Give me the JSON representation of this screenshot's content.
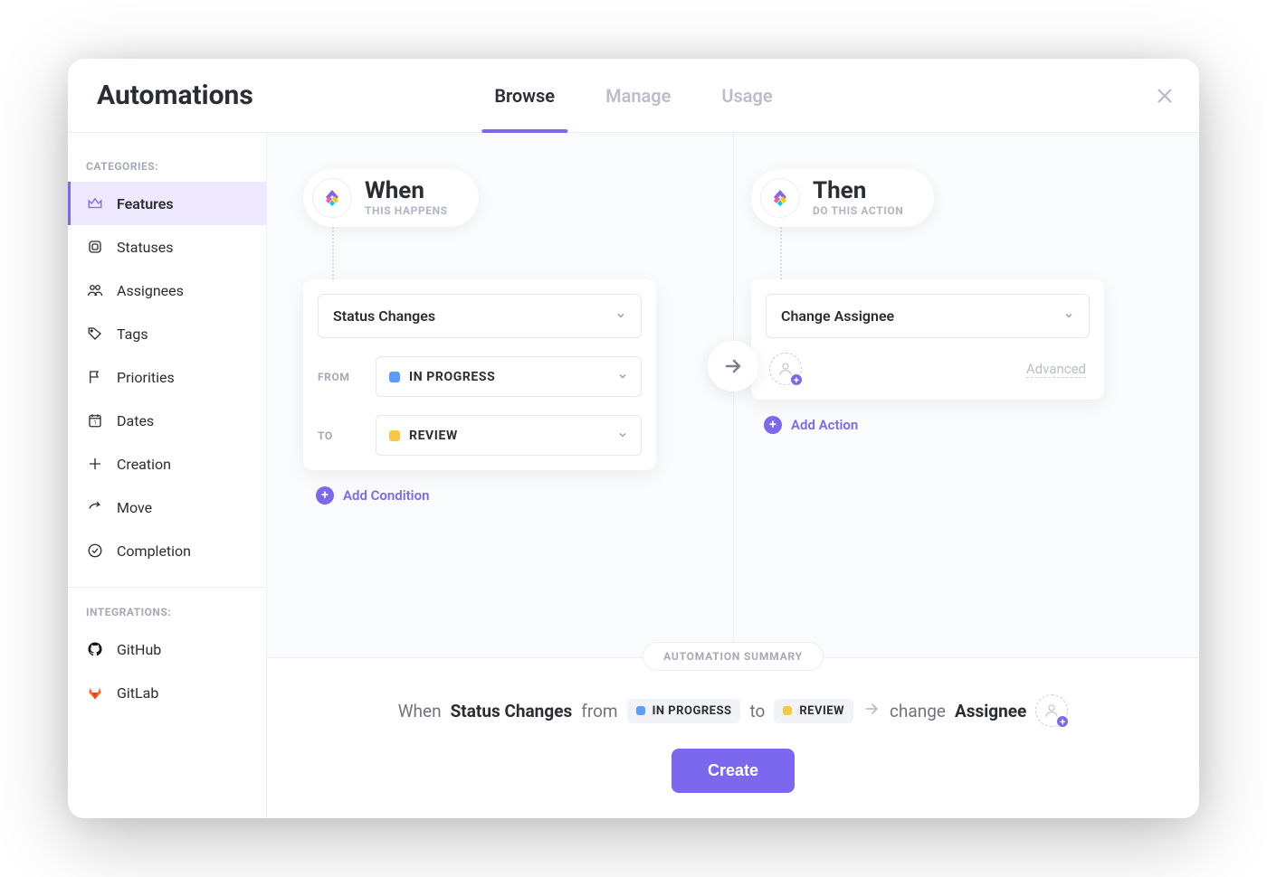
{
  "header": {
    "title": "Automations",
    "tabs": [
      {
        "label": "Browse",
        "active": true
      },
      {
        "label": "Manage",
        "active": false
      },
      {
        "label": "Usage",
        "active": false
      }
    ]
  },
  "sidebar": {
    "categories_label": "CATEGORIES:",
    "integrations_label": "INTEGRATIONS:",
    "categories": [
      {
        "label": "Features",
        "icon": "crown",
        "active": true
      },
      {
        "label": "Statuses",
        "icon": "square",
        "active": false
      },
      {
        "label": "Assignees",
        "icon": "people",
        "active": false
      },
      {
        "label": "Tags",
        "icon": "tag",
        "active": false
      },
      {
        "label": "Priorities",
        "icon": "flag",
        "active": false
      },
      {
        "label": "Dates",
        "icon": "calendar",
        "active": false
      },
      {
        "label": "Creation",
        "icon": "plus",
        "active": false
      },
      {
        "label": "Move",
        "icon": "share",
        "active": false
      },
      {
        "label": "Completion",
        "icon": "check-circle",
        "active": false
      }
    ],
    "integrations": [
      {
        "label": "GitHub",
        "icon": "github"
      },
      {
        "label": "GitLab",
        "icon": "gitlab"
      }
    ]
  },
  "when": {
    "title": "When",
    "subtitle": "THIS HAPPENS",
    "trigger": "Status Changes",
    "from_label": "FROM",
    "from_value": "IN PROGRESS",
    "from_color": "#5a9cff",
    "to_label": "TO",
    "to_value": "REVIEW",
    "to_color": "#f6c945",
    "add_condition": "Add Condition"
  },
  "then": {
    "title": "Then",
    "subtitle": "DO THIS ACTION",
    "action": "Change Assignee",
    "advanced": "Advanced",
    "add_action": "Add Action"
  },
  "summary": {
    "badge": "AUTOMATION SUMMARY",
    "when_prefix": "When",
    "trigger": "Status Changes",
    "from_word": "from",
    "from_value": "IN PROGRESS",
    "to_word": "to",
    "to_value": "REVIEW",
    "change_word": "change",
    "target": "Assignee",
    "create_label": "Create"
  }
}
